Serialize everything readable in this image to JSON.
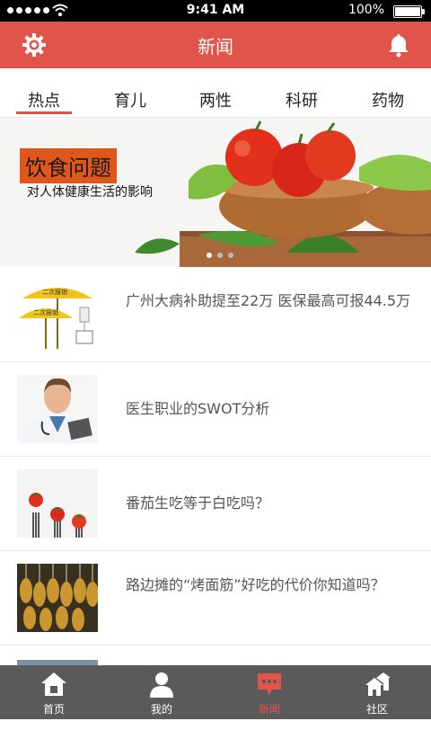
{
  "status_bar": {
    "time": "9:41 AM",
    "battery": "100%"
  },
  "header": {
    "title": "新闻"
  },
  "tabs": [
    {
      "label": "热点",
      "active": true
    },
    {
      "label": "育儿",
      "active": false
    },
    {
      "label": "两性",
      "active": false
    },
    {
      "label": "科研",
      "active": false
    },
    {
      "label": "药物",
      "active": false
    }
  ],
  "banner": {
    "headline": "饮食问题",
    "subtitle": "对人体健康生活的影响"
  },
  "news": [
    {
      "title": "广州大病补助提至22万 医保最高可报44.5万",
      "thumb": "umbrella-illustration",
      "thumb_labels": [
        "二次报销",
        "二次报销"
      ]
    },
    {
      "title": "医生职业的SWOT分析",
      "thumb": "doctor-photo"
    },
    {
      "title": "番茄生吃等于白吃吗？",
      "thumb": "tomato-forks-photo"
    },
    {
      "title": "路边摊的“烤面筋”好吃的代价你知道吗？",
      "thumb": "grilled-gluten-photo"
    }
  ],
  "tabbar": [
    {
      "label": "首页",
      "icon": "home-icon",
      "active": false
    },
    {
      "label": "我的",
      "icon": "user-icon",
      "active": false
    },
    {
      "label": "新闻",
      "icon": "chat-icon",
      "active": true
    },
    {
      "label": "社区",
      "icon": "community-icon",
      "active": false
    }
  ],
  "colors": {
    "accent": "#e0544a",
    "tabbar_bg": "#5a5a5a"
  }
}
